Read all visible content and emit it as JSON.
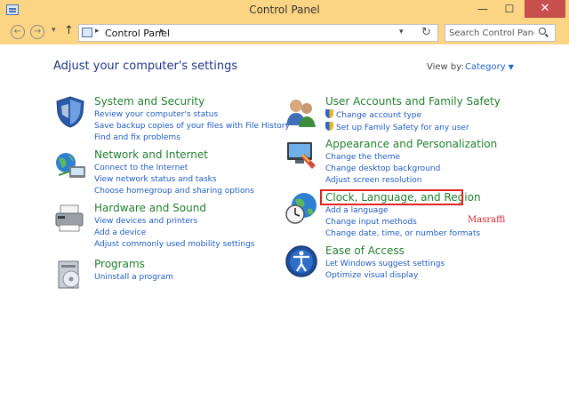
{
  "window": {
    "title": "Control Panel",
    "minimize": "—",
    "maximize": "☐",
    "close": "✕"
  },
  "nav": {
    "back": "←",
    "forward": "→",
    "recent": "▾",
    "up": "↑",
    "address_sep": "▸",
    "breadcrumb": "Control Panel",
    "address_dropdown": "▾",
    "refresh": "↻",
    "search_placeholder": "Search Control Panel"
  },
  "main": {
    "heading": "Adjust your computer's settings",
    "view_by_label": "View by:",
    "view_by_value": "Category",
    "view_by_caret": "▼"
  },
  "categories": [
    {
      "title": "System and Security",
      "icon": "system-security-icon",
      "links": [
        {
          "text": "Review your computer's status"
        },
        {
          "text": "Save backup copies of your files with File History"
        },
        {
          "text": "Find and fix problems"
        }
      ]
    },
    {
      "title": "Network and Internet",
      "icon": "network-icon",
      "links": [
        {
          "text": "Connect to the Internet"
        },
        {
          "text": "View network status and tasks"
        },
        {
          "text": "Choose homegroup and sharing options"
        }
      ]
    },
    {
      "title": "Hardware and Sound",
      "icon": "hardware-sound-icon",
      "links": [
        {
          "text": "View devices and printers"
        },
        {
          "text": "Add a device"
        },
        {
          "text": "Adjust commonly used mobility settings"
        }
      ]
    },
    {
      "title": "Programs",
      "icon": "programs-icon",
      "links": [
        {
          "text": "Uninstall a program"
        }
      ]
    },
    {
      "title": "User Accounts and Family Safety",
      "icon": "user-accounts-icon",
      "links": [
        {
          "text": "Change account type",
          "shield": true
        },
        {
          "text": "Set up Family Safety for any user",
          "shield": true
        }
      ]
    },
    {
      "title": "Appearance and Personalization",
      "icon": "appearance-icon",
      "links": [
        {
          "text": "Change the theme"
        },
        {
          "text": "Change desktop background"
        },
        {
          "text": "Adjust screen resolution"
        }
      ]
    },
    {
      "title": "Clock, Language, and Region",
      "icon": "clock-globe-icon",
      "links": [
        {
          "text": "Add a language"
        },
        {
          "text": "Change input methods"
        },
        {
          "text": "Change date, time, or number formats"
        }
      ]
    },
    {
      "title": "Ease of Access",
      "icon": "ease-of-access-icon",
      "links": [
        {
          "text": "Let Windows suggest settings"
        },
        {
          "text": "Optimize visual display"
        }
      ]
    }
  ],
  "watermark": "Masraffi",
  "colors": {
    "titlebar": "#fbd583",
    "heading": "#1e3287",
    "category_title": "#1f7e2e",
    "link": "#1f5bc1",
    "highlight": "#e0201e",
    "close_button": "#c74f4c"
  }
}
